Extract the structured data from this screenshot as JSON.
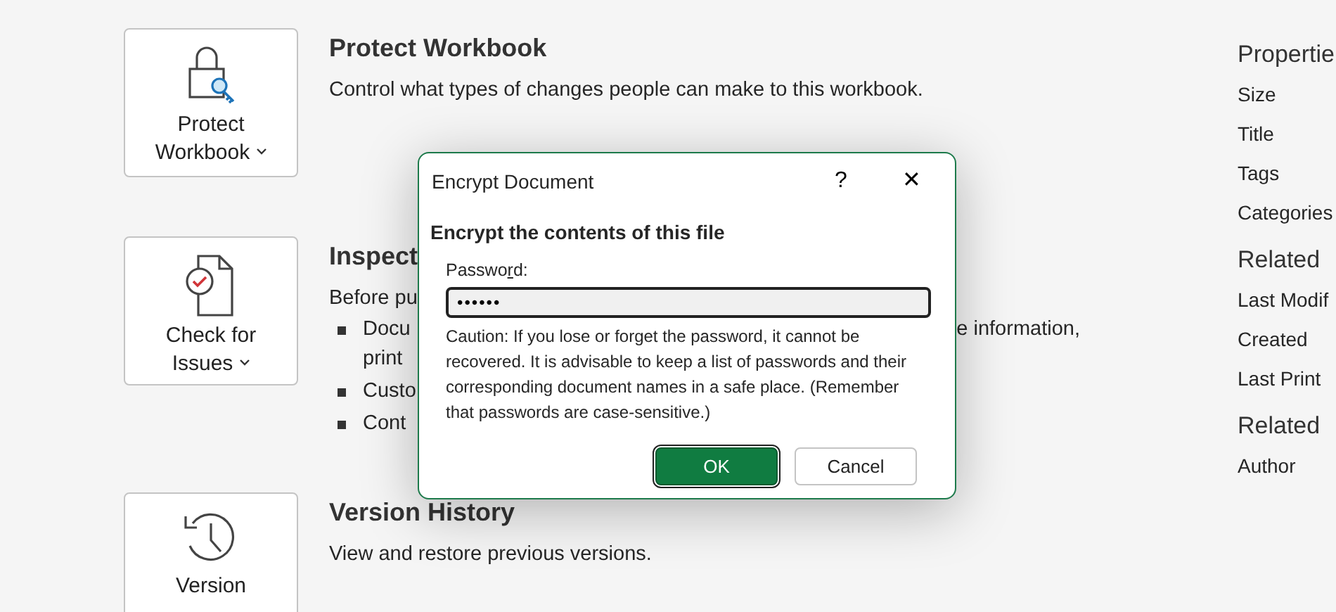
{
  "sections": [
    {
      "kind": "protect",
      "tile": [
        "Protect",
        "Workbook"
      ],
      "tile_dropdown": true,
      "title": "Protect Workbook",
      "description": "Control what types of changes people can make to this workbook."
    },
    {
      "kind": "inspect",
      "tile": [
        "Check for",
        "Issues"
      ],
      "tile_dropdown": true,
      "title": "Inspect",
      "description": "Before pu",
      "bullets": [
        {
          "lines": [
            {
              "left": "Docu",
              "right": "e information,"
            },
            {
              "left": "print"
            }
          ]
        },
        {
          "lines": [
            {
              "left": "Custo"
            }
          ]
        },
        {
          "lines": [
            {
              "left": "Cont"
            }
          ]
        }
      ]
    },
    {
      "kind": "history",
      "tile": [
        "Version"
      ],
      "tile_dropdown": false,
      "title": "Version History",
      "description": "View and restore previous versions."
    }
  ],
  "properties": {
    "groups": [
      {
        "title": "Propertie",
        "items": [
          "Size",
          "Title",
          "Tags",
          "Categories"
        ]
      },
      {
        "title": "Related",
        "items": [
          "Last Modif",
          "Created",
          "Last Print"
        ]
      },
      {
        "title": "Related",
        "items": [
          "Author"
        ]
      }
    ]
  },
  "dialog": {
    "title": "Encrypt Document",
    "help": "?",
    "close": "✕",
    "heading": "Encrypt the contents of this file",
    "password_label": {
      "before": "Passwo",
      "access_key": "r",
      "after": "d:"
    },
    "password_value": "••••••",
    "caution": "Caution: If you lose or forget the password, it cannot be recovered. It is advisable to keep a list of passwords and their corresponding document names in a safe place. (Remember that passwords are case-sensitive.)",
    "buttons": [
      {
        "label": "OK",
        "default": true
      },
      {
        "label": "Cancel",
        "default": false
      }
    ]
  }
}
